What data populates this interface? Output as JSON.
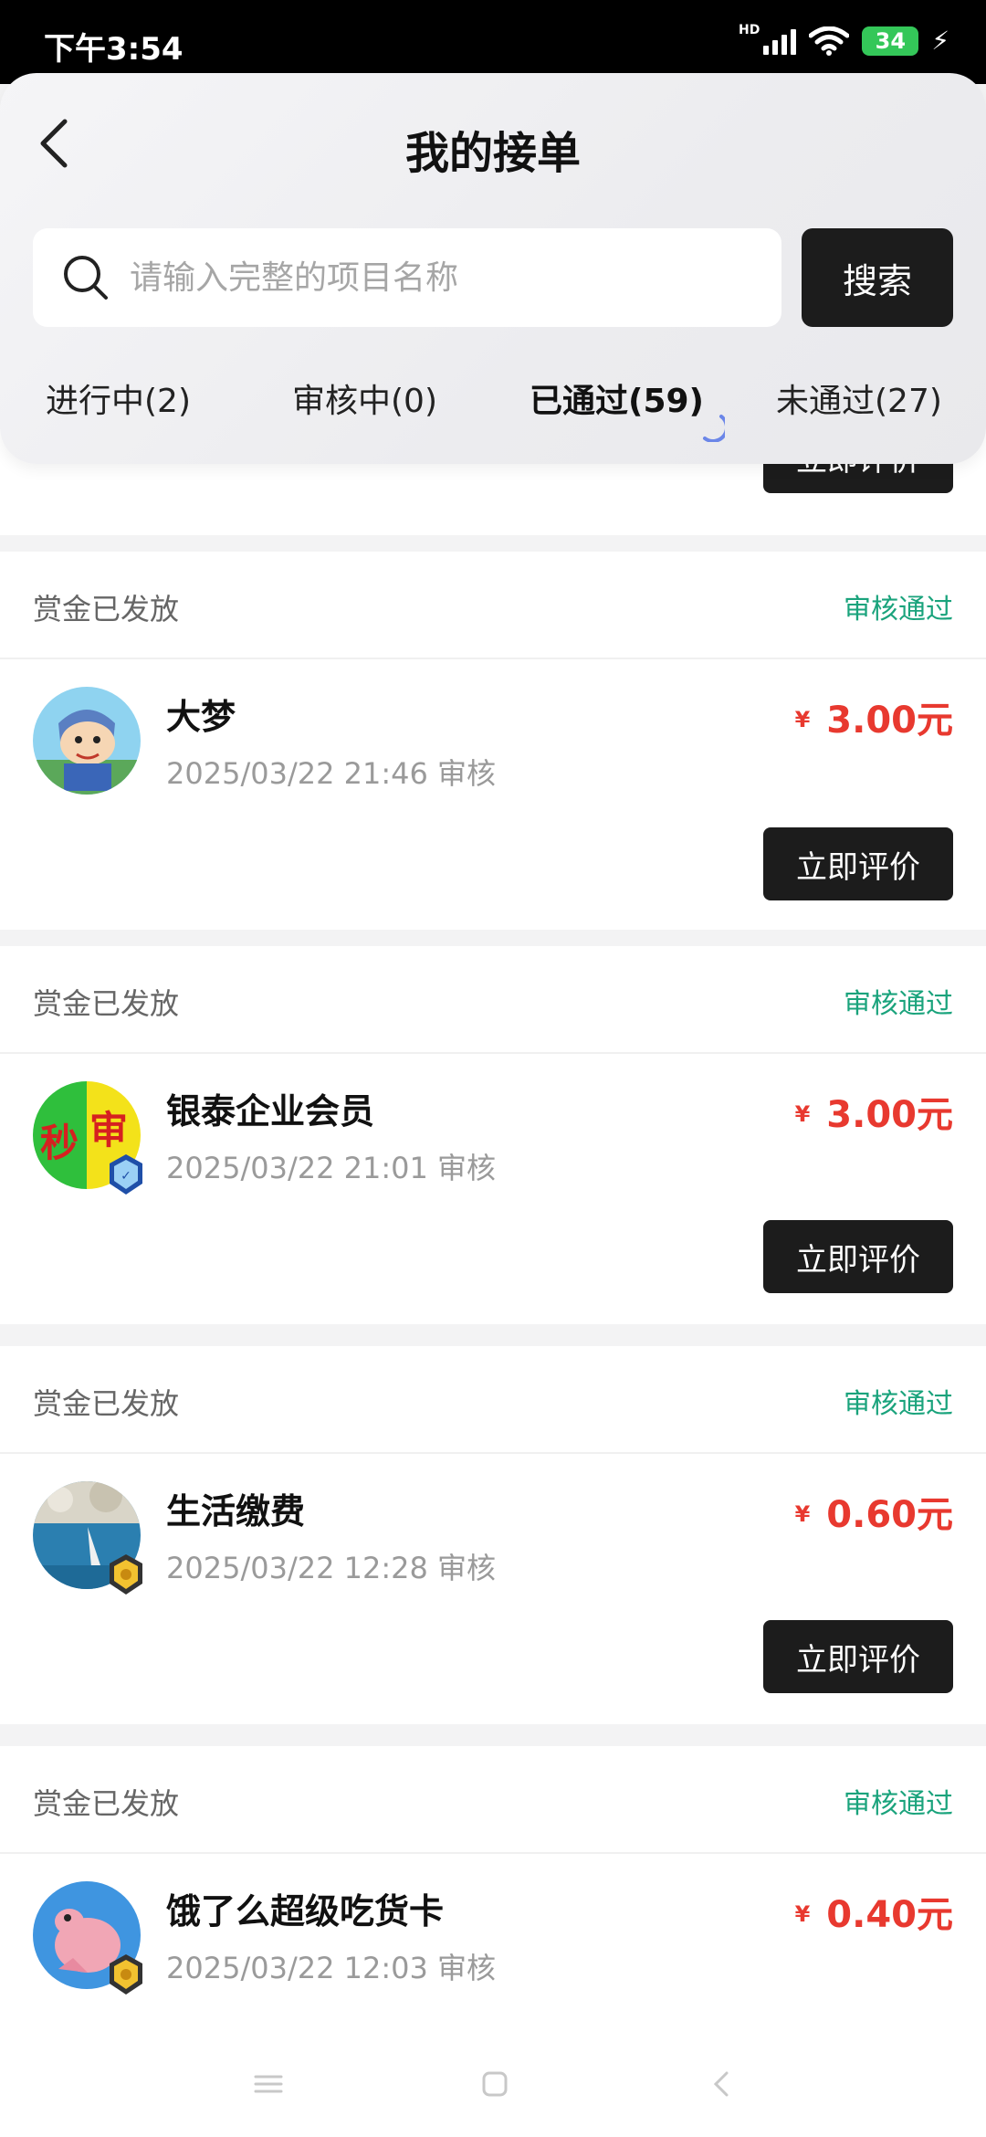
{
  "status_bar": {
    "time": "下午3:54",
    "network": "HD",
    "battery": "34"
  },
  "header": {
    "title": "我的接单",
    "search_placeholder": "请输入完整的项目名称",
    "search_button": "搜索"
  },
  "tabs": [
    {
      "label": "进行中(2)",
      "active": false
    },
    {
      "label": "审核中(0)",
      "active": false
    },
    {
      "label": "已通过(59)",
      "active": true
    },
    {
      "label": "未通过(27)",
      "active": false
    }
  ],
  "partial_card": {
    "rate_label": "立即评价"
  },
  "orders": [
    {
      "bounty_status": "赏金已发放",
      "review_status": "审核通过",
      "title": "大梦",
      "date": "2025/03/22 21:46 审核",
      "currency": "¥",
      "price": "3.00元",
      "rate_label": "立即评价"
    },
    {
      "bounty_status": "赏金已发放",
      "review_status": "审核通过",
      "title": "银泰企业会员",
      "date": "2025/03/22 21:01 审核",
      "currency": "¥",
      "price": "3.00元",
      "rate_label": "立即评价",
      "avatar_text": [
        "秒",
        "审"
      ]
    },
    {
      "bounty_status": "赏金已发放",
      "review_status": "审核通过",
      "title": "生活缴费",
      "date": "2025/03/22 12:28 审核",
      "currency": "¥",
      "price": "0.60元",
      "rate_label": "立即评价"
    },
    {
      "bounty_status": "赏金已发放",
      "review_status": "审核通过",
      "title": "饿了么超级吃货卡",
      "date": "2025/03/22 12:03 审核",
      "currency": "¥",
      "price": "0.40元"
    }
  ],
  "colors": {
    "accent_dark": "#1c1c1c",
    "price_red": "#e8392f",
    "approved_green": "#1aa37c"
  }
}
